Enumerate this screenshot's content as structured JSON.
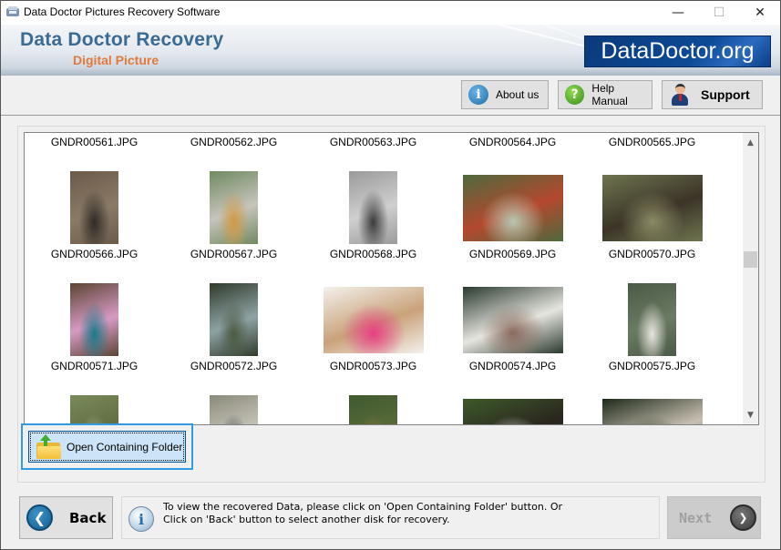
{
  "window": {
    "title": "Data Doctor Pictures Recovery Software",
    "controls": {
      "minimize": "—",
      "maximize": "☐",
      "close": "✕"
    }
  },
  "banner": {
    "brand_main": "Data Doctor Recovery",
    "brand_sub": "Digital Picture",
    "logo_text": "DataDoctor.org",
    "colors": {
      "brand_main": "#3b6a92",
      "brand_sub": "#e27a3d",
      "logo_bg": "#0d4a96"
    }
  },
  "toolbar": {
    "about_label": "About us",
    "about_icon": "i",
    "help_label": "Help Manual",
    "help_icon": "?",
    "support_label": "Support"
  },
  "image_list": {
    "rows": [
      {
        "visible": "labels-only",
        "items": [
          {
            "name": "GNDR00561.JPG"
          },
          {
            "name": "GNDR00562.JPG"
          },
          {
            "name": "GNDR00563.JPG"
          },
          {
            "name": "GNDR00564.JPG"
          },
          {
            "name": "GNDR00565.JPG"
          }
        ]
      },
      {
        "visible": "full",
        "items": [
          {
            "name": "GNDR00566.JPG",
            "orientation": "portrait",
            "colors": [
              "#6b5a4a",
              "#2e2a26",
              "#8a7a66"
            ]
          },
          {
            "name": "GNDR00567.JPG",
            "orientation": "portrait",
            "colors": [
              "#6f8a60",
              "#d29a45",
              "#c7c4bd"
            ]
          },
          {
            "name": "GNDR00568.JPG",
            "orientation": "portrait",
            "colors": [
              "#9a9a9a",
              "#3a3a3a",
              "#cfcfcf"
            ]
          },
          {
            "name": "GNDR00569.JPG",
            "orientation": "landscape",
            "colors": [
              "#4e6a3e",
              "#b8c7b0",
              "#b4482e"
            ]
          },
          {
            "name": "GNDR00570.JPG",
            "orientation": "landscape",
            "colors": [
              "#6f7450",
              "#8a8a64",
              "#3b3427"
            ]
          }
        ]
      },
      {
        "visible": "full",
        "items": [
          {
            "name": "GNDR00571.JPG",
            "orientation": "portrait",
            "colors": [
              "#5b4433",
              "#1b7a8a",
              "#d79ac4"
            ]
          },
          {
            "name": "GNDR00572.JPG",
            "orientation": "portrait",
            "colors": [
              "#2f3a2a",
              "#4b5a42",
              "#8fa3a5"
            ]
          },
          {
            "name": "GNDR00573.JPG",
            "orientation": "landscape",
            "colors": [
              "#f4f1ec",
              "#e73f82",
              "#c9a27a"
            ]
          },
          {
            "name": "GNDR00574.JPG",
            "orientation": "landscape",
            "colors": [
              "#2b3a2e",
              "#8a6a5e",
              "#e6e6e0"
            ]
          },
          {
            "name": "GNDR00575.JPG",
            "orientation": "portrait",
            "colors": [
              "#4a5a46",
              "#e8e6e2",
              "#6b7a62"
            ]
          }
        ]
      },
      {
        "visible": "partial",
        "items": [
          {
            "name": "",
            "orientation": "portrait",
            "colors": [
              "#7a8a5a",
              "#b3b69a",
              "#5e6b40"
            ]
          },
          {
            "name": "",
            "orientation": "portrait",
            "colors": [
              "#8a8a7a",
              "#3a3c4a",
              "#c9c7bc"
            ]
          },
          {
            "name": "",
            "orientation": "portrait",
            "colors": [
              "#3e5a2e",
              "#8a7a3a",
              "#5b6b3a"
            ]
          },
          {
            "name": "",
            "orientation": "landscape",
            "colors": [
              "#3d5a2a",
              "#d9dbd7",
              "#2a241e"
            ]
          },
          {
            "name": "",
            "orientation": "landscape",
            "colors": [
              "#1e2a1a",
              "#3b4a2a",
              "#c9c1b3"
            ]
          }
        ]
      }
    ],
    "scroll_position": 0.42
  },
  "open_folder": {
    "label": "Open Containing Folder"
  },
  "footer": {
    "back_label": "Back",
    "next_label": "Next",
    "info_line1": "To view the recovered Data, please click on 'Open Containing Folder' button. Or",
    "info_line2": "Click on 'Back' button to select another disk for recovery."
  }
}
